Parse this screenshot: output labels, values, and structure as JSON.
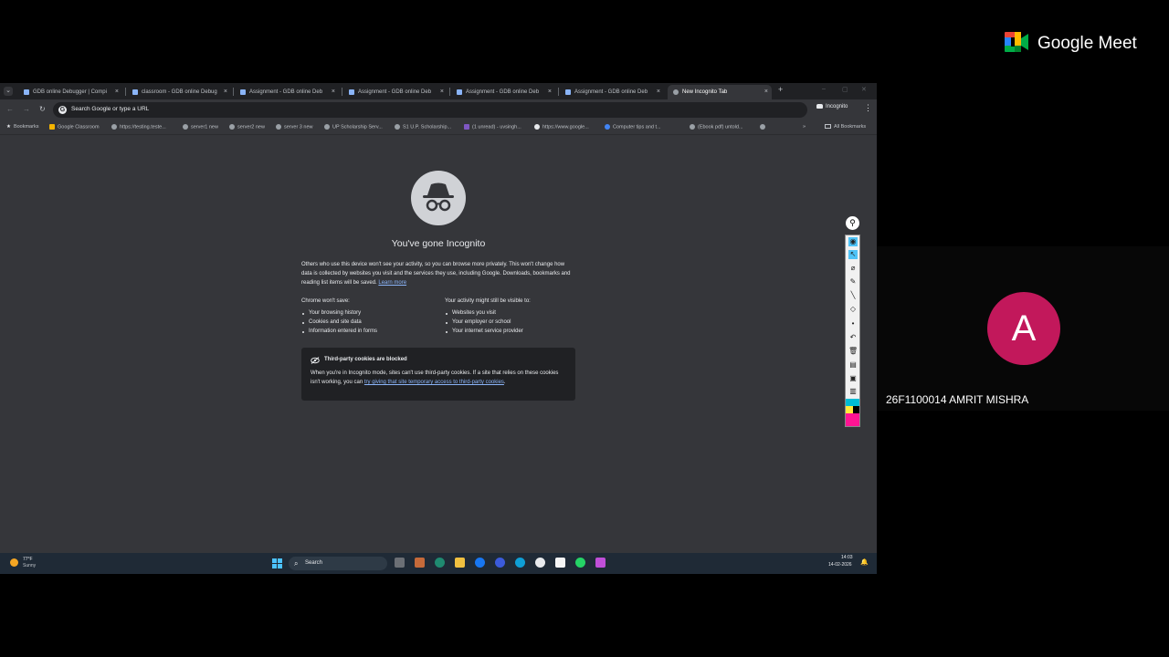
{
  "browser": {
    "tabs": [
      {
        "label": "GDB online Debugger | Compi",
        "active": false
      },
      {
        "label": "classroom - GDB online Debug",
        "active": false
      },
      {
        "label": "Assignment - GDB online Deb",
        "active": false
      },
      {
        "label": "Assignment - GDB online Deb",
        "active": false
      },
      {
        "label": "Assignment - GDB online Deb",
        "active": false
      },
      {
        "label": "Assignment - GDB online Deb",
        "active": false
      },
      {
        "label": "New Incognito Tab",
        "active": true
      }
    ],
    "tab_close": "×",
    "new_tab": "+",
    "omnibox_placeholder": "Search Google or type a URL",
    "incognito_label": "Incognito",
    "bookmarks": [
      "Bookmarks",
      "Google Classroom",
      "https://testing.teste...",
      "server1 new",
      "server2 new",
      "server 3 new",
      "UP Scholarship Serv...",
      "S1 U.P. Scholarship...",
      "(1 unread) - uvsingh...",
      "https://www.google...",
      "Computer tips and t...",
      "(Ebook pdf) untold..."
    ],
    "bookmarks_overflow": "»",
    "all_bookmarks": "All Bookmarks"
  },
  "page": {
    "title": "You've gone Incognito",
    "intro": "Others who use this device won't see your activity, so you can browse more privately. This won't change how data is collected by websites you visit and the services they use, including Google. Downloads, bookmarks and reading list items will be saved.",
    "learn_more": "Learn more",
    "wont_save_heading": "Chrome won't save:",
    "wont_save_items": [
      "Your browsing history",
      "Cookies and site data",
      "Information entered in forms"
    ],
    "visible_heading": "Your activity might still be visible to:",
    "visible_items": [
      "Websites you visit",
      "Your employer or school",
      "Your internet service provider"
    ],
    "cookie_title": "Third-party cookies are blocked",
    "cookie_text": "When you're in Incognito mode, sites can't use third-party cookies. If a site that relies on these cookies isn't working, you can",
    "cookie_link": "try giving that site temporary access to third-party cookies",
    "cookie_end": "."
  },
  "taskbar": {
    "weather_temp": "77°F",
    "weather_desc": "Sunny",
    "search_label": "Search",
    "time": "14:03",
    "date": "14-02-2026"
  },
  "meet": {
    "app_name": "Google Meet",
    "participant_initial": "A",
    "participant_name": "26F1100014 AMRIT MISHRA",
    "avatar_color": "#c2185b"
  },
  "colors": {
    "browser_bg": "#35363a",
    "tabstrip_bg": "#202124",
    "link": "#8ab4f8",
    "taskbar_bg": "#1f2a36"
  }
}
